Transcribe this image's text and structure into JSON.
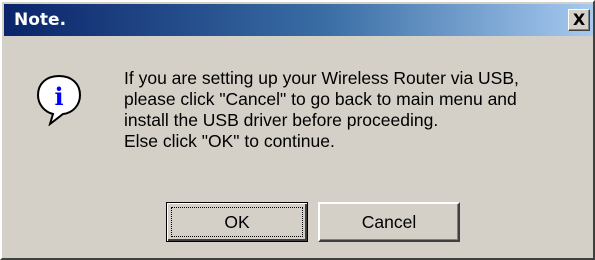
{
  "window": {
    "title": "Note.",
    "close_label": "X"
  },
  "icon": {
    "name": "information-icon",
    "glyph": "i",
    "color": "#0000ff"
  },
  "message": {
    "lines": [
      "If you are setting up your Wireless Router via USB,",
      "please click \"Cancel\" to go back to main menu and",
      "install the USB driver before proceeding.",
      "Else click \"OK\" to continue."
    ]
  },
  "buttons": {
    "ok_label": "OK",
    "cancel_label": "Cancel"
  },
  "colors": {
    "titlebar_start": "#0a246a",
    "titlebar_end": "#a6caf0",
    "face": "#d4d0c8"
  }
}
